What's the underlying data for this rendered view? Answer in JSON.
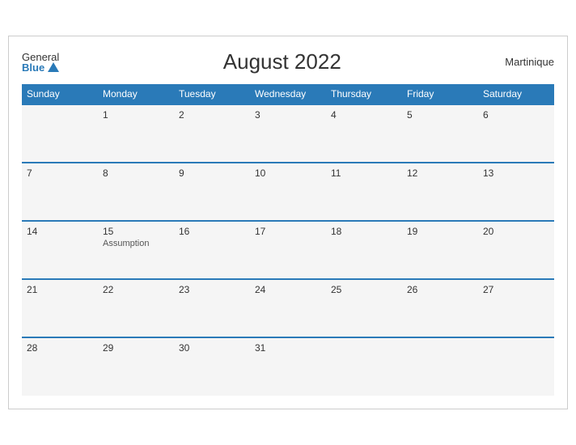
{
  "header": {
    "logo_general": "General",
    "logo_blue": "Blue",
    "title": "August 2022",
    "region": "Martinique"
  },
  "weekdays": [
    "Sunday",
    "Monday",
    "Tuesday",
    "Wednesday",
    "Thursday",
    "Friday",
    "Saturday"
  ],
  "weeks": [
    [
      {
        "day": "",
        "event": ""
      },
      {
        "day": "1",
        "event": ""
      },
      {
        "day": "2",
        "event": ""
      },
      {
        "day": "3",
        "event": ""
      },
      {
        "day": "4",
        "event": ""
      },
      {
        "day": "5",
        "event": ""
      },
      {
        "day": "6",
        "event": ""
      }
    ],
    [
      {
        "day": "7",
        "event": ""
      },
      {
        "day": "8",
        "event": ""
      },
      {
        "day": "9",
        "event": ""
      },
      {
        "day": "10",
        "event": ""
      },
      {
        "day": "11",
        "event": ""
      },
      {
        "day": "12",
        "event": ""
      },
      {
        "day": "13",
        "event": ""
      }
    ],
    [
      {
        "day": "14",
        "event": ""
      },
      {
        "day": "15",
        "event": "Assumption"
      },
      {
        "day": "16",
        "event": ""
      },
      {
        "day": "17",
        "event": ""
      },
      {
        "day": "18",
        "event": ""
      },
      {
        "day": "19",
        "event": ""
      },
      {
        "day": "20",
        "event": ""
      }
    ],
    [
      {
        "day": "21",
        "event": ""
      },
      {
        "day": "22",
        "event": ""
      },
      {
        "day": "23",
        "event": ""
      },
      {
        "day": "24",
        "event": ""
      },
      {
        "day": "25",
        "event": ""
      },
      {
        "day": "26",
        "event": ""
      },
      {
        "day": "27",
        "event": ""
      }
    ],
    [
      {
        "day": "28",
        "event": ""
      },
      {
        "day": "29",
        "event": ""
      },
      {
        "day": "30",
        "event": ""
      },
      {
        "day": "31",
        "event": ""
      },
      {
        "day": "",
        "event": ""
      },
      {
        "day": "",
        "event": ""
      },
      {
        "day": "",
        "event": ""
      }
    ]
  ]
}
